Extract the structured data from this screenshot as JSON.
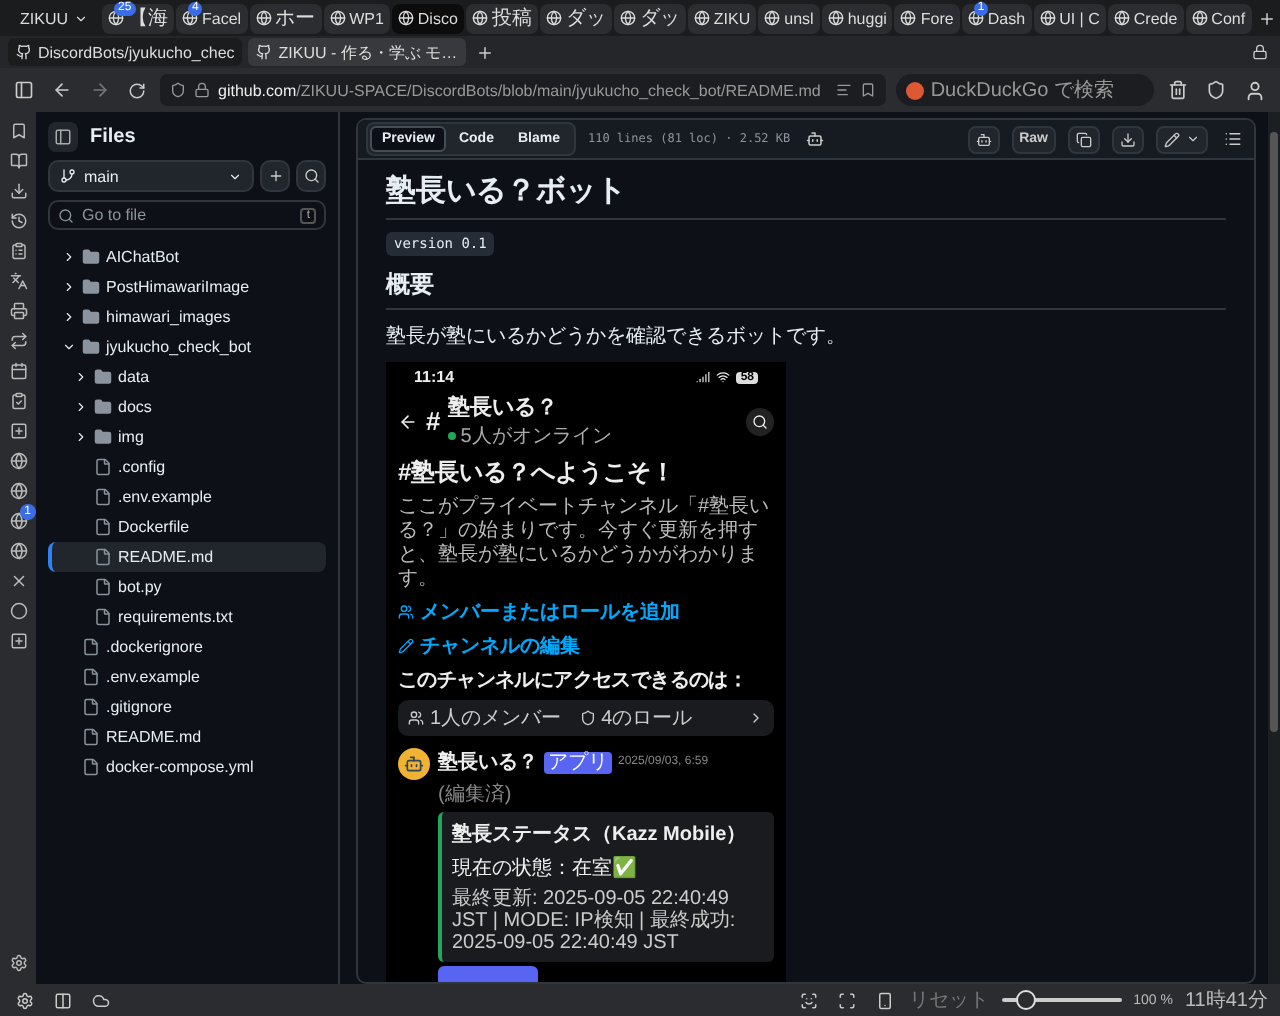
{
  "browser": {
    "workspace": "ZIKUU",
    "tabs": [
      {
        "title": "【海",
        "badge": "25",
        "selected": false
      },
      {
        "title": "Facel",
        "badge": "4",
        "selected": false
      },
      {
        "title": "ホー",
        "selected": false
      },
      {
        "title": "WP1",
        "selected": false
      },
      {
        "title": "Disco",
        "selected": true
      },
      {
        "title": "投稿",
        "selected": false
      },
      {
        "title": "ダッ",
        "selected": false
      },
      {
        "title": "ダッ",
        "selected": false
      },
      {
        "title": "ZIKU",
        "selected": false
      },
      {
        "title": "unsl",
        "selected": false
      },
      {
        "title": "huggi",
        "selected": false
      },
      {
        "title": "Fore",
        "selected": false
      },
      {
        "title": "Dash",
        "badge": "1",
        "selected": false
      },
      {
        "title": "UI | C",
        "selected": false
      },
      {
        "title": "Crede",
        "selected": false
      },
      {
        "title": "Conf",
        "selected": false
      }
    ]
  },
  "page_tabs": [
    {
      "title": "DiscordBots/jyukucho_chec",
      "selected": true
    },
    {
      "title": "ZIKUU - 作る・学ぶ モ…",
      "selected": false
    }
  ],
  "address": {
    "host": "github.com",
    "path": "/ZIKUU-SPACE/DiscordBots/blob/main/jyukucho_check_bot/README.md",
    "search_placeholder": "DuckDuckGo で検索"
  },
  "panel_badge": "1",
  "files": {
    "title": "Files",
    "branch": "main",
    "search_placeholder": "Go to file",
    "shortcut": "t",
    "tree": [
      {
        "kind": "folder",
        "name": "AIChatBot",
        "expanded": false,
        "selected": false
      },
      {
        "kind": "folder",
        "name": "PostHimawariImage",
        "expanded": false,
        "selected": false
      },
      {
        "kind": "folder",
        "name": "himawari_images",
        "expanded": false,
        "selected": false
      },
      {
        "kind": "folder",
        "name": "jyukucho_check_bot",
        "expanded": true,
        "selected": false,
        "children": [
          {
            "kind": "folder",
            "name": "data",
            "expanded": false,
            "selected": false
          },
          {
            "kind": "folder",
            "name": "docs",
            "expanded": false,
            "selected": false
          },
          {
            "kind": "folder",
            "name": "img",
            "expanded": false,
            "selected": false
          },
          {
            "kind": "file",
            "name": ".config",
            "selected": false
          },
          {
            "kind": "file",
            "name": ".env.example",
            "selected": false
          },
          {
            "kind": "file",
            "name": "Dockerfile",
            "selected": false
          },
          {
            "kind": "file",
            "name": "README.md",
            "selected": true
          },
          {
            "kind": "file",
            "name": "bot.py",
            "selected": false
          },
          {
            "kind": "file",
            "name": "requirements.txt",
            "selected": false
          }
        ]
      },
      {
        "kind": "file",
        "name": ".dockerignore",
        "selected": false
      },
      {
        "kind": "file",
        "name": ".env.example",
        "selected": false
      },
      {
        "kind": "file",
        "name": ".gitignore",
        "selected": false
      },
      {
        "kind": "file",
        "name": "README.md",
        "selected": false
      },
      {
        "kind": "file",
        "name": "docker-compose.yml",
        "selected": false
      }
    ]
  },
  "viewer": {
    "tabs": [
      {
        "label": "Preview",
        "selected": true
      },
      {
        "label": "Code",
        "selected": false
      },
      {
        "label": "Blame",
        "selected": false
      }
    ],
    "info": "110 lines (81 loc) · 2.52 KB",
    "raw": "Raw"
  },
  "readme": {
    "title": "塾長いる？ボット",
    "version": "version 0.1",
    "heading": "概要",
    "text": "塾長が塾にいるかどうかを確認できるボットです。"
  },
  "phone": {
    "time": "11:14",
    "battery": "58",
    "hash": "#",
    "channel": "塾長いる？",
    "online": "5人がオンライン",
    "welcome": "#塾長いる？へようこそ！",
    "intro": "ここがプライベートチャンネル「#塾長いる？」の始まりです。今すぐ更新を押すと、塾長が塾にいるかどうかがわかります。",
    "links": [
      "メンバーまたはロールを追加",
      "チャンネルの編集"
    ],
    "access_label": "このチャンネルにアクセスできるのは：",
    "members": "1人のメンバー",
    "roles": "4のロール",
    "message": {
      "author": "塾長いる？",
      "tag": "アプリ",
      "date": "2025/09/03, 6:59",
      "edited": "(編集済)",
      "embed_title": "塾長ステータス（Kazz Mobile）",
      "state": "現在の状態：在室✅",
      "footer": "最終更新: 2025-09-05 22:40:49 JST | MODE: IP検知 | 最終成功: 2025-09-05 22:40:49 JST"
    }
  },
  "status_bar": {
    "reset": "リセット",
    "zoom_slider": {
      "level": 0.2
    },
    "zoom": "100 %",
    "time": "11時41分"
  }
}
